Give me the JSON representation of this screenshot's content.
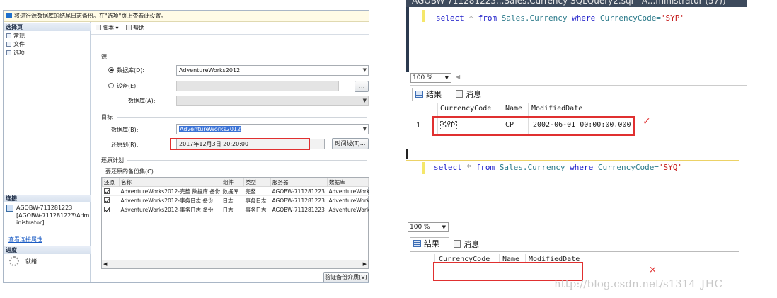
{
  "restore": {
    "message": "将进行源数据库的结尾日志备份。在\"选项\"页上查看此设置。",
    "left": {
      "select_page_header": "选择页",
      "pages": [
        "常规",
        "文件",
        "选项"
      ],
      "connection_header": "连接",
      "server_name": "AGOBW-711281223",
      "login": "[AGOBW-711281223\\Administrator]",
      "view_connection_link": "查看连接属性",
      "progress_header": "进度",
      "progress_status": "就绪"
    },
    "toolbar": {
      "script": "脚本",
      "help": "帮助"
    },
    "source": {
      "group": "源",
      "database_radio": "数据库(D):",
      "database_value": "AdventureWorks2012",
      "device_radio": "设备(E):",
      "device_db_label": "数据库(A):",
      "browse": "..."
    },
    "destination": {
      "group": "目标",
      "database_label": "数据库(B):",
      "database_value": "AdventureWorks2012",
      "restore_to_label": "还原到(R):",
      "restore_to_value": "2017年12月3日 20:20:00",
      "timeline_button": "时间线(T)..."
    },
    "plan": {
      "group": "还原计划",
      "backupsets_label": "要还原的备份集(C):",
      "columns": [
        "还原",
        "名称",
        "组件",
        "类型",
        "服务器",
        "数据库"
      ],
      "rows": [
        {
          "name": "AdventureWorks2012-完整 数据库 备份",
          "component": "数据库",
          "type": "完整",
          "server": "AGOBW-711281223",
          "database": "AdventureWorks2012"
        },
        {
          "name": "AdventureWorks2012-事务日志 备份",
          "component": "日志",
          "type": "事务日志",
          "server": "AGOBW-711281223",
          "database": "AdventureWorks2012"
        },
        {
          "name": "AdventureWorks2012-事务日志 备份",
          "component": "日志",
          "type": "事务日志",
          "server": "AGOBW-711281223",
          "database": "AdventureWorks2012"
        }
      ],
      "verify_button": "验证备份介质(V)"
    }
  },
  "query1": {
    "tabs_text": "AGOBW-711281223...Sales.Currency     SQLQuery2.sql - A...ministrator (57))",
    "sql": {
      "kw1": "select",
      "star": " * ",
      "kw2": "from",
      "obj": " Sales.Currency ",
      "kw3": "where",
      "col": " CurrencyCode=",
      "str": "'SYP'"
    },
    "zoom": "100 %",
    "results_tab": "结果",
    "messages_tab": "消息",
    "columns": [
      "CurrencyCode",
      "Name",
      "ModifiedDate"
    ],
    "row": {
      "num": "1",
      "code": "SYP",
      "name": "CP",
      "date": "2002-06-01 00:00:00.000"
    },
    "mark": "✓"
  },
  "query2": {
    "sql": {
      "kw1": "select",
      "star": " * ",
      "kw2": "from",
      "obj": " Sales.Currency ",
      "kw3": "where",
      "col": " CurrencyCode=",
      "str": "'SYQ'"
    },
    "zoom": "100 %",
    "results_tab": "结果",
    "messages_tab": "消息",
    "columns": [
      "CurrencyCode",
      "Name",
      "ModifiedDate"
    ],
    "mark": "×"
  },
  "watermark": "http://blog.csdn.net/s1314_JHC",
  "colors": {
    "annotation_red": "#e03030",
    "keyword": "#1c1cc9",
    "string": "#c41a1a"
  }
}
